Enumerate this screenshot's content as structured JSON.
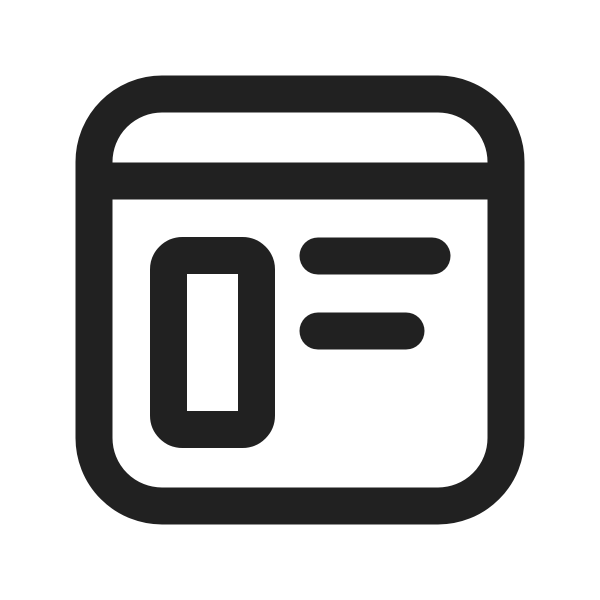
{
  "icon": {
    "name": "app-window-layout-icon",
    "stroke_color": "#212121",
    "background_color": "#ffffff"
  }
}
